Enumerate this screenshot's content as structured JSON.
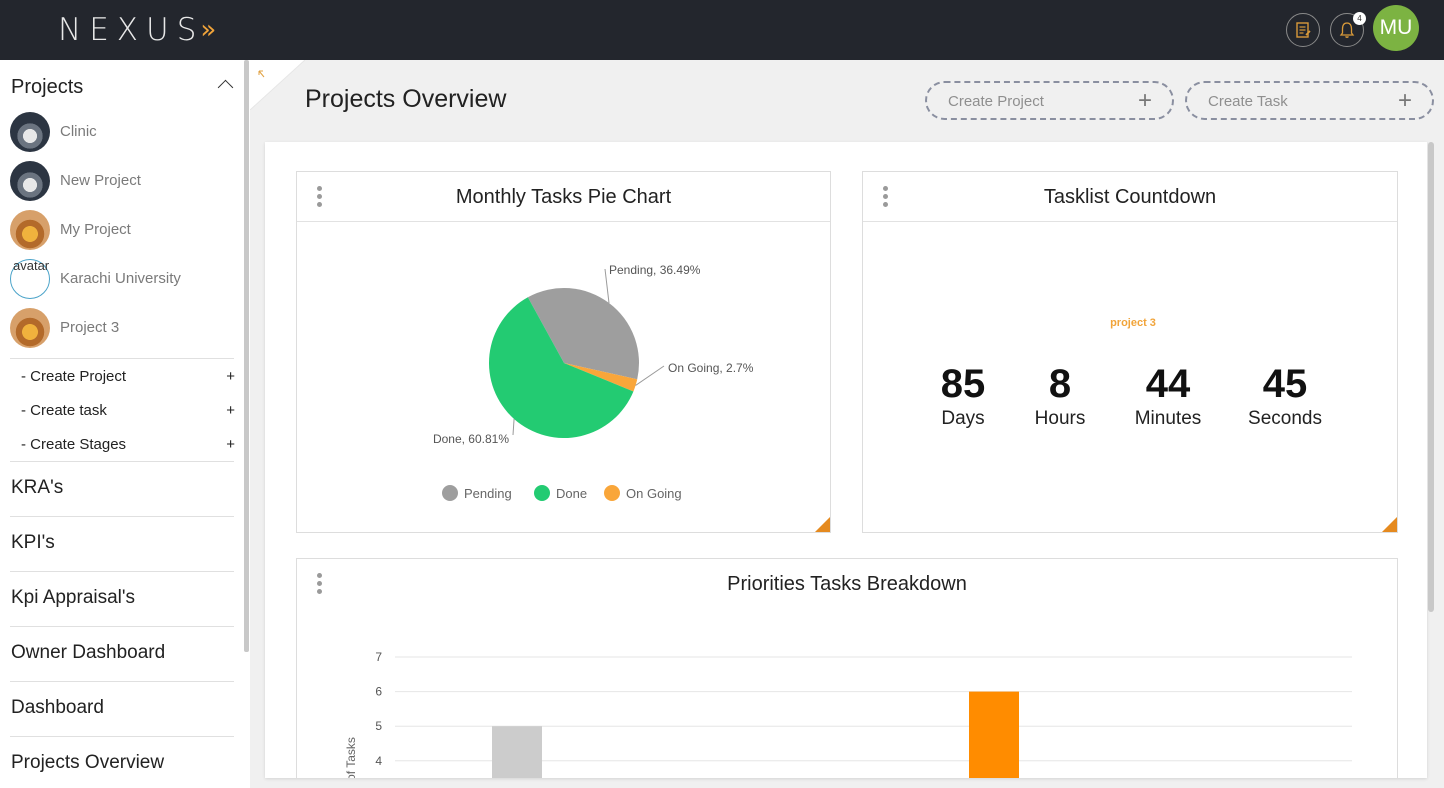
{
  "header": {
    "logo_text": "NEXUS",
    "logo_mark": "»",
    "notification_count": "4",
    "user_initials": "MU",
    "icons": [
      "notes-icon",
      "bell-icon"
    ],
    "colors": {
      "topbar": "#23262d",
      "accent": "#f1a43a",
      "avatar": "#7cb342"
    }
  },
  "sidebar": {
    "heading": "Projects",
    "projects": [
      {
        "name": "Clinic",
        "avatar": "car"
      },
      {
        "name": "New Project",
        "avatar": "car"
      },
      {
        "name": "My Project",
        "avatar": "truck"
      },
      {
        "name": "Karachi University",
        "avatar": "broken",
        "alt": "avatar"
      },
      {
        "name": "Project 3",
        "avatar": "truck"
      }
    ],
    "actions": [
      {
        "label": "- Create Project",
        "icon": "+"
      },
      {
        "label": "- Create task",
        "icon": "+"
      },
      {
        "label": "- Create Stages",
        "icon": "+"
      }
    ],
    "menu": [
      "KRA's",
      "KPI's",
      "Kpi Appraisal's",
      "Owner Dashboard",
      "Dashboard",
      "Projects Overview"
    ]
  },
  "page": {
    "title": "Projects Overview",
    "create_project": "Create Project",
    "create_task": "Create Task",
    "plus": "+"
  },
  "pie_card": {
    "title": "Monthly Tasks Pie Chart"
  },
  "countdown": {
    "title": "Tasklist Countdown",
    "project": "project 3",
    "units": [
      {
        "value": "85",
        "label": "Days"
      },
      {
        "value": "8",
        "label": "Hours"
      },
      {
        "value": "44",
        "label": "Minutes"
      },
      {
        "value": "45",
        "label": "Seconds"
      }
    ]
  },
  "bar_card": {
    "title": "Priorities Tasks Breakdown"
  },
  "chart_data": [
    {
      "type": "pie",
      "title": "Monthly Tasks Pie Chart",
      "slices": [
        {
          "name": "Pending",
          "value": 36.49,
          "label": "Pending, 36.49%",
          "color": "#9e9e9e"
        },
        {
          "name": "On Going",
          "value": 2.7,
          "label": "On Going, 2.7%",
          "color": "#f9a63a"
        },
        {
          "name": "Done",
          "value": 60.81,
          "label": "Done, 60.81%",
          "color": "#23cb72"
        }
      ],
      "legend": [
        "Pending",
        "Done",
        "On Going"
      ],
      "legend_position": "bottom"
    },
    {
      "type": "bar",
      "title": "Priorities Tasks Breakdown",
      "ylabel": "of Tasks",
      "ytick_labels": [
        "4",
        "5",
        "6",
        "7"
      ],
      "visible_yrange": [
        4,
        7
      ],
      "grid": true,
      "bars": [
        {
          "value": 5,
          "color": "#cccccc"
        },
        {
          "value": 6,
          "color": "#ff8c00"
        }
      ]
    }
  ]
}
